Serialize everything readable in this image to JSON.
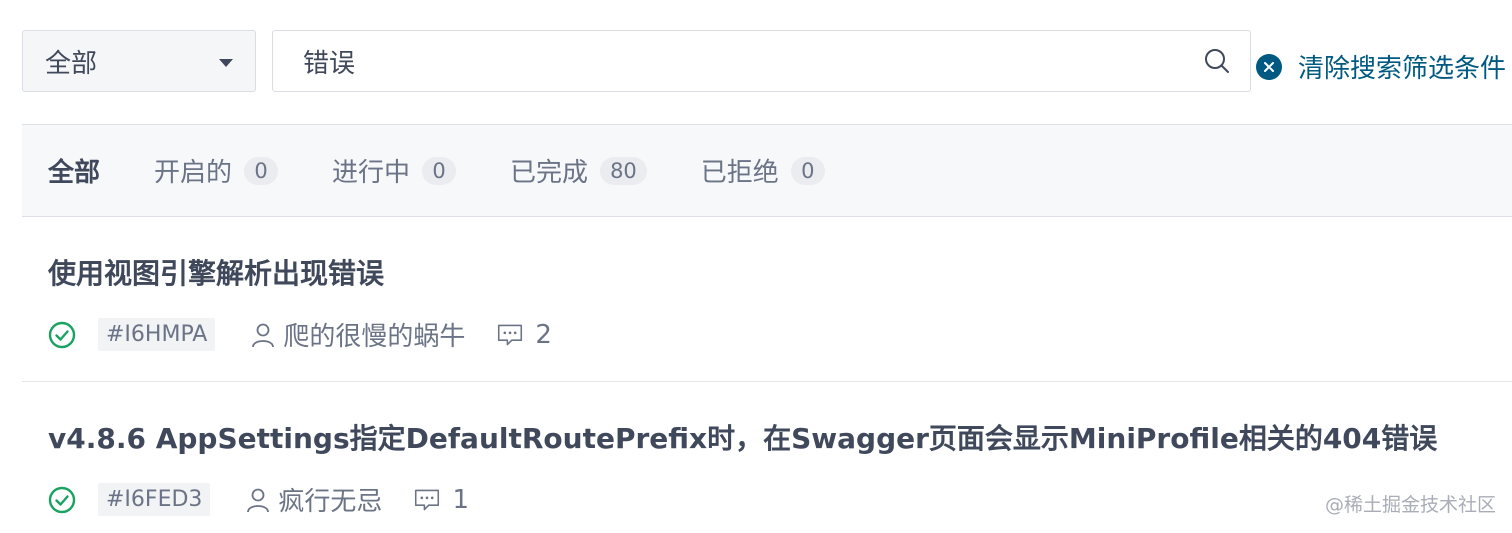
{
  "filter": {
    "selected": "全部"
  },
  "search": {
    "value": "错误"
  },
  "clear_filter": {
    "label": "清除搜索筛选条件"
  },
  "tabs": [
    {
      "label": "全部",
      "count": ""
    },
    {
      "label": "开启的",
      "count": "0"
    },
    {
      "label": "进行中",
      "count": "0"
    },
    {
      "label": "已完成",
      "count": "80"
    },
    {
      "label": "已拒绝",
      "count": "0"
    }
  ],
  "issues": [
    {
      "title": "使用视图引擎解析出现错误",
      "id": "#I6HMPA",
      "author": "爬的很慢的蜗牛",
      "comments": "2",
      "status": "completed"
    },
    {
      "title": "v4.8.6 AppSettings指定DefaultRoutePrefix时，在Swagger页面会显示MiniProfile相关的404错误",
      "id": "#I6FED3",
      "author": "疯行无忌",
      "comments": "1",
      "status": "completed"
    }
  ],
  "watermark": "@稀土掘金技术社区",
  "colors": {
    "accent": "#005980",
    "success": "#1aa260"
  },
  "icons": {
    "search": "search-icon",
    "clear": "close-circle-icon",
    "status": "check-circle-icon",
    "author": "user-icon",
    "comment": "comment-icon"
  }
}
